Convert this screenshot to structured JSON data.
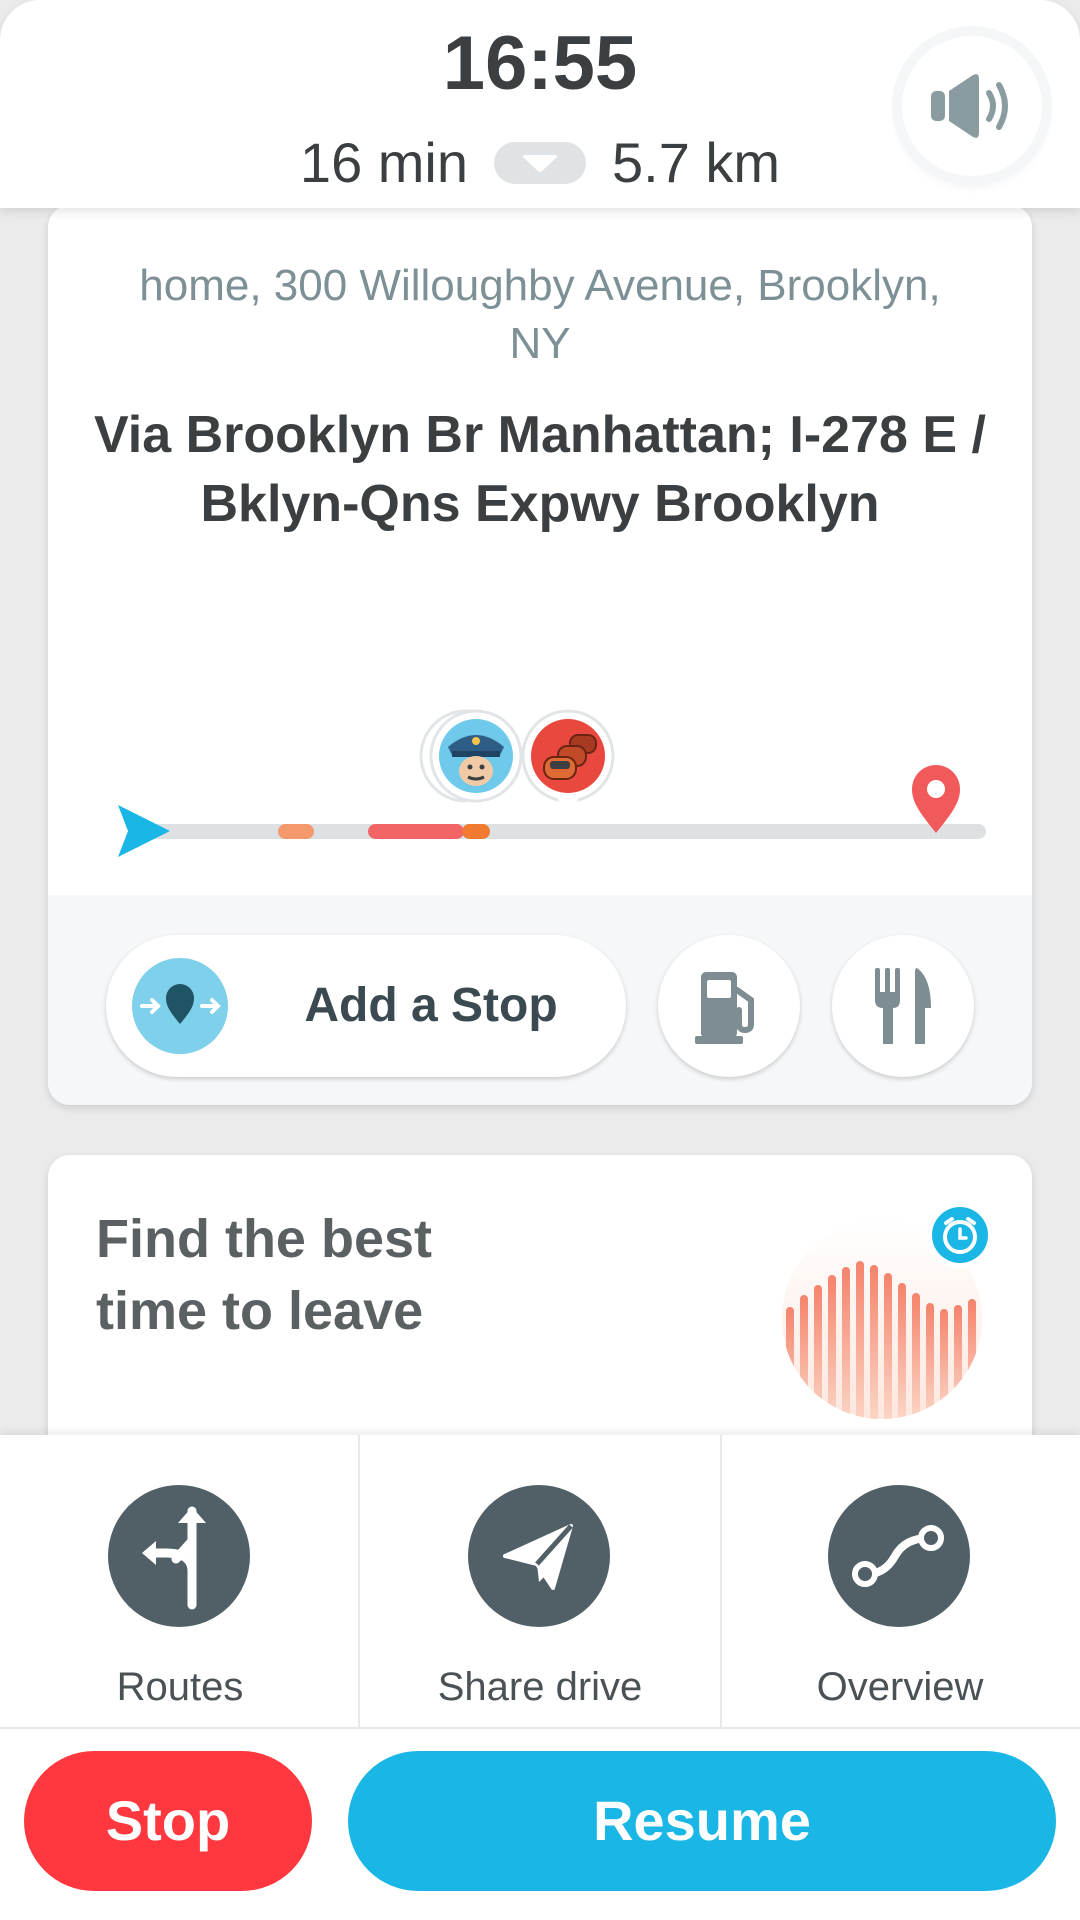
{
  "header": {
    "clock": "16:55",
    "duration": "16 min",
    "distance": "5.7 km"
  },
  "route": {
    "destination": "home, 300 Willoughby Avenue, Brooklyn, NY",
    "via": "Via Brooklyn Br Manhattan; I-278 E / Bklyn-Qns Expwy Brooklyn"
  },
  "actions_row": {
    "add_stop_label": "Add a Stop"
  },
  "promo": {
    "title": "Find the best time to leave"
  },
  "bottom_actions": {
    "routes_label": "Routes",
    "share_label": "Share drive",
    "overview_label": "Overview"
  },
  "buttons": {
    "stop_label": "Stop",
    "resume_label": "Resume"
  },
  "colors": {
    "accent": "#1ab6e5",
    "stop": "#ff383f",
    "icon_dark": "#516066",
    "traffic_light": "#f4996c",
    "traffic_heavy": "#f26565",
    "destination_pin": "#f15a5a"
  }
}
